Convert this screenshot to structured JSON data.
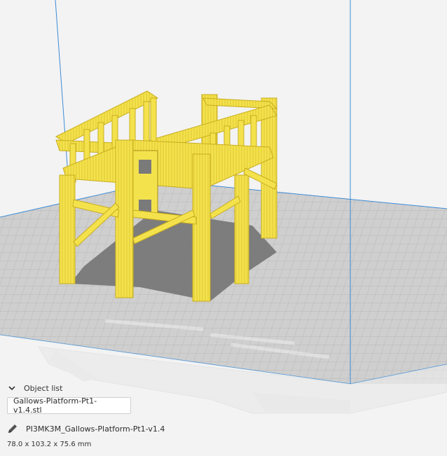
{
  "object_list": {
    "header_label": "Object list",
    "toggle_icon": "chevron-down-icon",
    "selected_file": "Gallows-Platform-Pt1-v1.4.stl"
  },
  "job": {
    "edit_icon": "pencil-icon",
    "name": "PI3MK3M_Gallows-Platform-Pt1-v1.4",
    "dimensions": "78.0 x 103.2 x 75.6 mm"
  },
  "colors": {
    "model_yellow": "#f4e24d",
    "model_shadow": "#d3b92a",
    "build_plate": "#cfcfcf",
    "volume_edge": "#3d8cd6",
    "background": "#f3f3f3"
  }
}
